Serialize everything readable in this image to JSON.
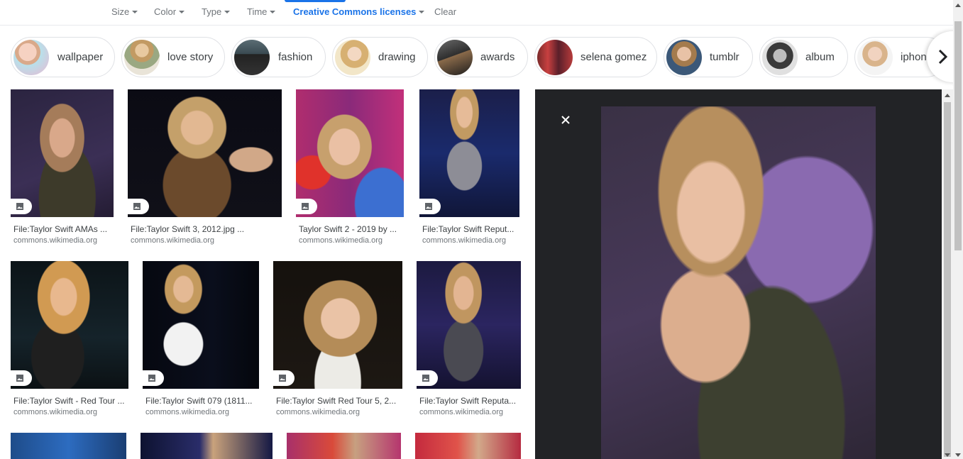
{
  "filters": {
    "size": "Size",
    "color": "Color",
    "type": "Type",
    "time": "Time",
    "license": "Creative Commons licenses",
    "clear": "Clear"
  },
  "chips": [
    {
      "label": "wallpaper"
    },
    {
      "label": "love story"
    },
    {
      "label": "fashion"
    },
    {
      "label": "drawing"
    },
    {
      "label": "awards"
    },
    {
      "label": "selena gomez"
    },
    {
      "label": "tumblr"
    },
    {
      "label": "album"
    },
    {
      "label": "iphone"
    }
  ],
  "results": [
    {
      "title": "File:Taylor Swift AMAs ...",
      "source": "commons.wikimedia.org"
    },
    {
      "title": "File:Taylor Swift 3, 2012.jpg ...",
      "source": "commons.wikimedia.org"
    },
    {
      "title": "Taylor Swift 2 - 2019 by ...",
      "source": "commons.wikimedia.org"
    },
    {
      "title": "File:Taylor Swift Reput...",
      "source": "commons.wikimedia.org"
    },
    {
      "title": "File:Taylor Swift - Red Tour ...",
      "source": "commons.wikimedia.org"
    },
    {
      "title": "File:Taylor Swift 079 (1811...",
      "source": "commons.wikimedia.org"
    },
    {
      "title": "File:Taylor Swift Red Tour 5, 2...",
      "source": "commons.wikimedia.org"
    },
    {
      "title": "File:Taylor Swift Reputa...",
      "source": "commons.wikimedia.org"
    }
  ],
  "colors": {
    "accent": "#1a73e8",
    "preview_bg": "#222326"
  },
  "icons": {
    "chip_next": "chevron-right-icon",
    "close": "close-icon",
    "badge": "image-icon"
  }
}
